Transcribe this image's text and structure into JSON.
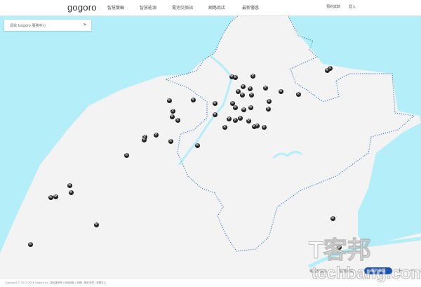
{
  "header": {
    "logo": "gogoro",
    "nav": [
      "智慧雙輪",
      "智慧能源",
      "電池交換站",
      "網路商店",
      "最新優惠"
    ],
    "right": [
      "預約試騎",
      "登入"
    ]
  },
  "search": {
    "placeholder": "尋找 Gogoro 服務中心"
  },
  "legend": {
    "battery_station": "電池交換站",
    "service_point": "服務據點",
    "my_location": "我的位置"
  },
  "zoom": {
    "in": "+",
    "out": "−"
  },
  "footer": {
    "copyright": "Copyright © 2015-2016 Gogoro Inc. 隱私權政策 | 使用條款 | 官網 | 關於我們 | 新聞中心"
  },
  "watermark": {
    "line1": "T客邦",
    "line2": "techbang.com"
  },
  "colors": {
    "sea": "#b3eef9",
    "land": "#f3f3f3",
    "marker": "#222222",
    "accent": "#1a55b5",
    "border": "#2a6fc0"
  }
}
